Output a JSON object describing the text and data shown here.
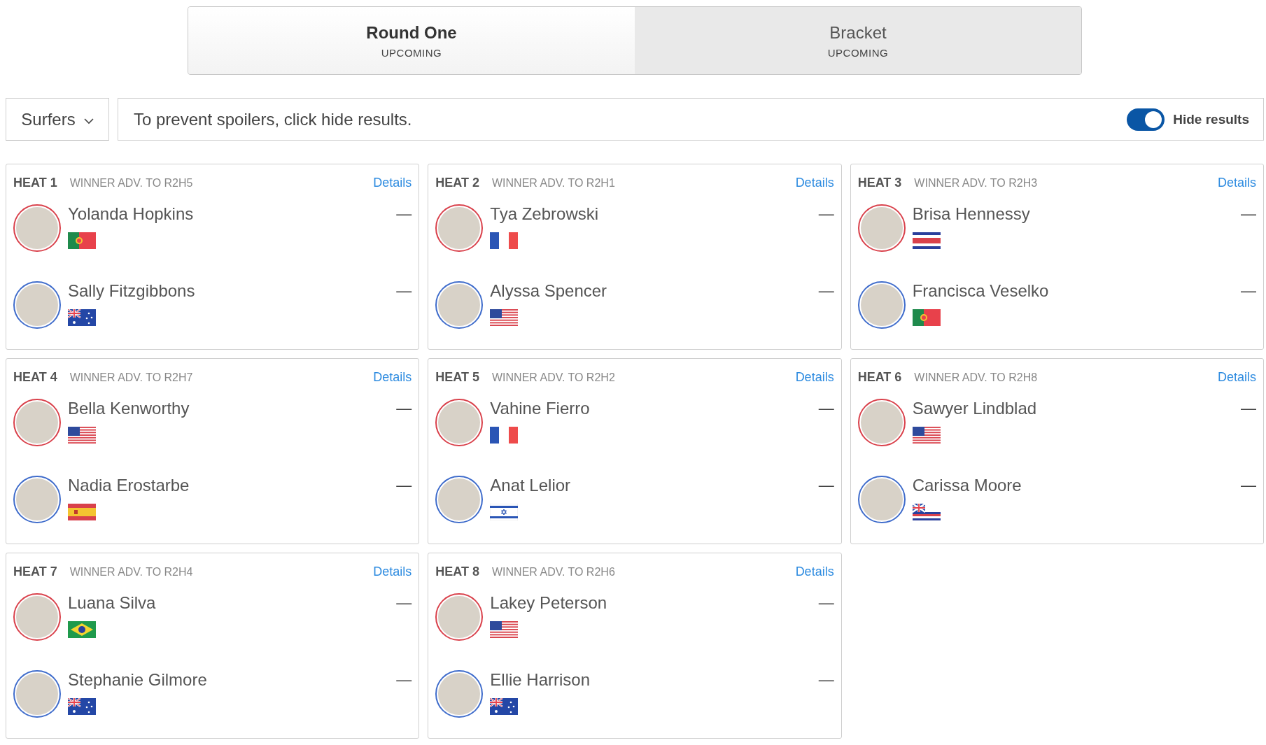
{
  "tabs": [
    {
      "title": "Round One",
      "status": "UPCOMING",
      "selected": true
    },
    {
      "title": "Bracket",
      "status": "UPCOMING",
      "selected": false
    }
  ],
  "filter": {
    "label": "Surfers"
  },
  "notice": "To prevent spoilers, click hide results.",
  "hide_results": {
    "label": "Hide results",
    "on": true
  },
  "heats": [
    {
      "title": "HEAT 1",
      "advance": "WINNER ADV. TO R2H5",
      "link": "Details",
      "surfers": [
        {
          "name": "Yolanda Hopkins",
          "kind": "portugal",
          "color": "#d9414b",
          "score": "—"
        },
        {
          "name": "Sally Fitzgibbons",
          "kind": "australia",
          "color": "#3f6ccb",
          "score": "—"
        }
      ]
    },
    {
      "title": "HEAT 2",
      "advance": "WINNER ADV. TO R2H1",
      "link": "Details",
      "surfers": [
        {
          "name": "Tya Zebrowski",
          "kind": "france",
          "color": "#d9414b",
          "score": "—"
        },
        {
          "name": "Alyssa Spencer",
          "kind": "usa",
          "color": "#3f6ccb",
          "score": "—"
        }
      ]
    },
    {
      "title": "HEAT 3",
      "advance": "WINNER ADV. TO R2H3",
      "link": "Details",
      "surfers": [
        {
          "name": "Brisa Hennessy",
          "kind": "costarica",
          "color": "#d9414b",
          "score": "—"
        },
        {
          "name": "Francisca Veselko",
          "kind": "portugal",
          "color": "#3f6ccb",
          "score": "—"
        }
      ]
    },
    {
      "title": "HEAT 4",
      "advance": "WINNER ADV. TO R2H7",
      "link": "Details",
      "surfers": [
        {
          "name": "Bella Kenworthy",
          "kind": "usa",
          "color": "#d9414b",
          "score": "—"
        },
        {
          "name": "Nadia Erostarbe",
          "kind": "spain",
          "color": "#3f6ccb",
          "score": "—"
        }
      ]
    },
    {
      "title": "HEAT 5",
      "advance": "WINNER ADV. TO R2H2",
      "link": "Details",
      "surfers": [
        {
          "name": "Vahine Fierro",
          "kind": "france",
          "color": "#d9414b",
          "score": "—"
        },
        {
          "name": "Anat Lelior",
          "kind": "israel",
          "color": "#3f6ccb",
          "score": "—"
        }
      ]
    },
    {
      "title": "HEAT 6",
      "advance": "WINNER ADV. TO R2H8",
      "link": "Details",
      "surfers": [
        {
          "name": "Sawyer Lindblad",
          "kind": "usa",
          "color": "#d9414b",
          "score": "—"
        },
        {
          "name": "Carissa Moore",
          "kind": "hawaii",
          "color": "#3f6ccb",
          "score": "—"
        }
      ]
    },
    {
      "title": "HEAT 7",
      "advance": "WINNER ADV. TO R2H4",
      "link": "Details",
      "surfers": [
        {
          "name": "Luana Silva",
          "kind": "brazil",
          "color": "#d9414b",
          "score": "—"
        },
        {
          "name": "Stephanie Gilmore",
          "kind": "australia",
          "color": "#3f6ccb",
          "score": "—"
        }
      ]
    },
    {
      "title": "HEAT 8",
      "advance": "WINNER ADV. TO R2H6",
      "link": "Details",
      "surfers": [
        {
          "name": "Lakey Peterson",
          "kind": "usa",
          "color": "#d9414b",
          "score": "—"
        },
        {
          "name": "Ellie Harrison",
          "kind": "australia",
          "color": "#3f6ccb",
          "score": "—"
        }
      ]
    }
  ]
}
